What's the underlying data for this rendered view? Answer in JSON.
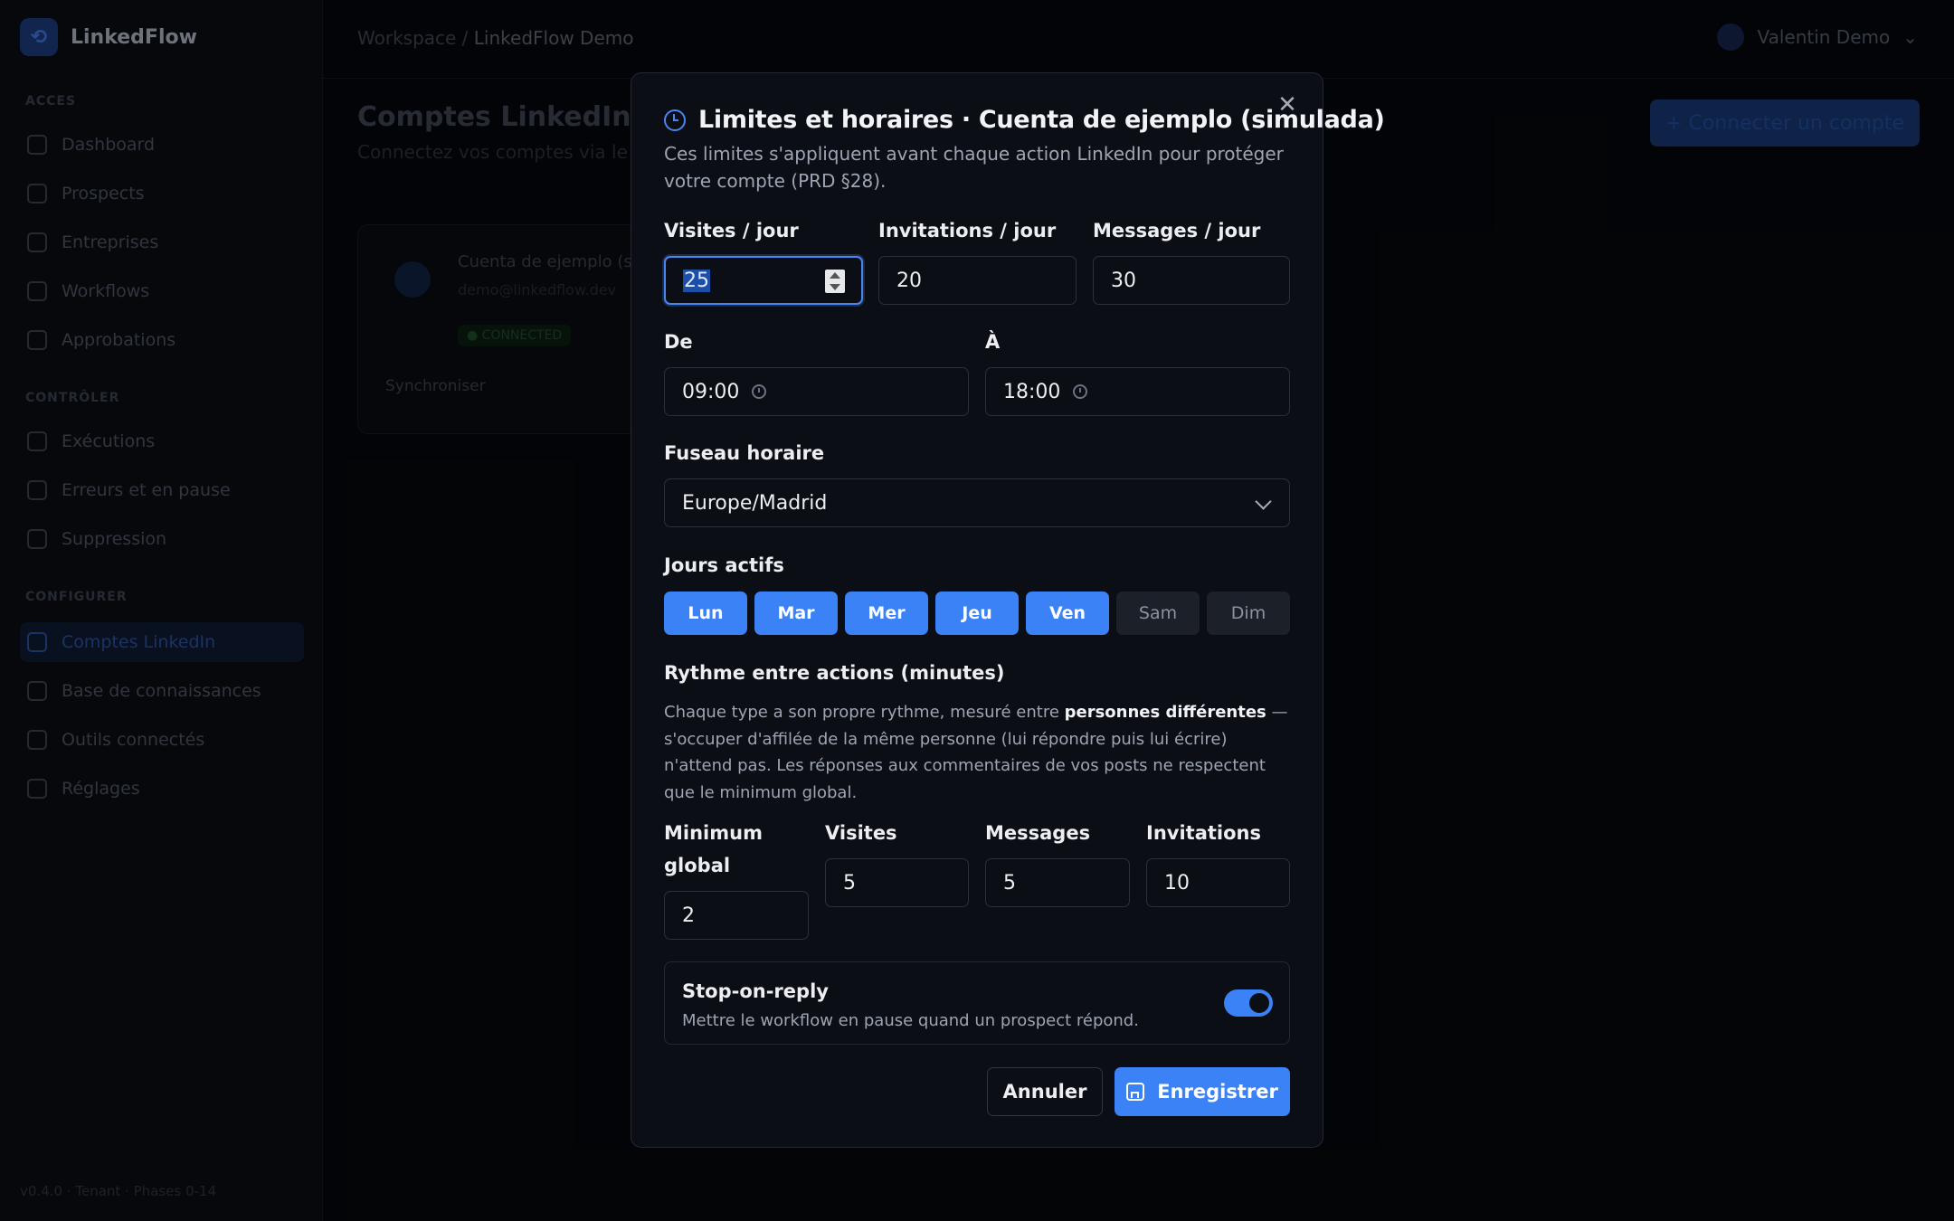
{
  "background": {
    "brand": "LinkedFlow",
    "nav_sections": [
      "ACCES",
      "CONTRÔLER",
      "CONFIGURER"
    ],
    "nav_items": [
      "Dashboard",
      "Prospects",
      "Entreprises",
      "Workflows",
      "Approbations",
      "Exécutions",
      "Erreurs et en pause",
      "Suppression",
      "Comptes LinkedIn",
      "Base de connaissances",
      "Outils connectés",
      "Réglages"
    ],
    "version": "v0.4.0 · Tenant · Phases 0-14",
    "breadcrumb_root": "Workspace",
    "breadcrumb_current": "LinkedFlow Demo",
    "user": "Valentin Demo",
    "page_title": "Comptes LinkedIn",
    "page_subtitle": "Connectez vos comptes via le",
    "connect_button": "+ Connecter un compte",
    "card_name": "Cuenta de ejemplo (s",
    "card_email": "demo@linkedflow.dev",
    "card_status": "● CONNECTED",
    "card_action": "Synchroniser"
  },
  "modal": {
    "close_icon": "close-icon",
    "title": "Limites et horaires · Cuenta de ejemplo (simulada)",
    "description": "Ces limites s'appliquent avant chaque action LinkedIn pour protéger votre compte (PRD §28).",
    "limits": {
      "visits_label": "Visites / jour",
      "visits_value": "25",
      "invitations_label": "Invitations / jour",
      "invitations_value": "20",
      "messages_label": "Messages / jour",
      "messages_value": "30"
    },
    "hours": {
      "from_label": "De",
      "from_value": "09:00",
      "to_label": "À",
      "to_value": "18:00"
    },
    "timezone": {
      "label": "Fuseau horaire",
      "value": "Europe/Madrid"
    },
    "active_days": {
      "label": "Jours actifs",
      "days": [
        {
          "label": "Lun",
          "active": true
        },
        {
          "label": "Mar",
          "active": true
        },
        {
          "label": "Mer",
          "active": true
        },
        {
          "label": "Jeu",
          "active": true
        },
        {
          "label": "Ven",
          "active": true
        },
        {
          "label": "Sam",
          "active": false
        },
        {
          "label": "Dim",
          "active": false
        }
      ]
    },
    "rhythm": {
      "title": "Rythme entre actions (minutes)",
      "desc_before": "Chaque type a son propre rythme, mesuré entre ",
      "desc_bold": "personnes différentes",
      "desc_after": " — s'occuper d'affilée de la même personne (lui répondre puis lui écrire) n'attend pas. Les réponses aux commentaires de vos posts ne respectent que le minimum global.",
      "global_label": "Minimum global",
      "global_value": "2",
      "visits_label": "Visites",
      "visits_value": "5",
      "messages_label": "Messages",
      "messages_value": "5",
      "invitations_label": "Invitations",
      "invitations_value": "10"
    },
    "stop_on_reply": {
      "title": "Stop-on-reply",
      "description": "Mettre le workflow en pause quand un prospect répond.",
      "enabled": true
    },
    "cancel_label": "Annuler",
    "save_label": "Enregistrer",
    "accent": "#3b82f6"
  }
}
